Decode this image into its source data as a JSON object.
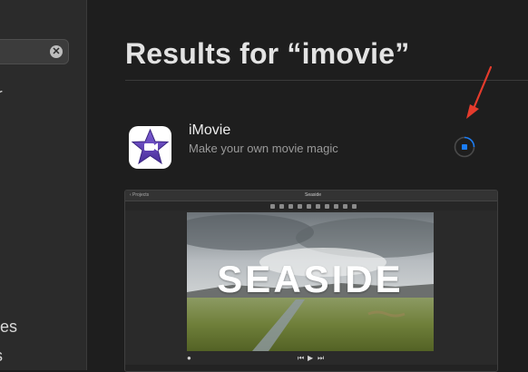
{
  "sidebar": {
    "search": {
      "clear_icon": "clear-circle-icon"
    },
    "fragment_top": "r",
    "fragment_ies": "ies",
    "fragment_s": "s"
  },
  "main": {
    "title": "Results for “imovie”",
    "result": {
      "name": "iMovie",
      "subtitle": "Make your own movie magic",
      "icon": "imovie-star-icon",
      "download_state": "downloading"
    },
    "preview": {
      "topbar_back": "‹ Projects",
      "topbar_title": "Seaside",
      "video_text": "SEASIDE"
    }
  },
  "colors": {
    "accent": "#1a7cf5",
    "arrow": "#e53b2c",
    "icon_purple": "#5a3da8"
  }
}
